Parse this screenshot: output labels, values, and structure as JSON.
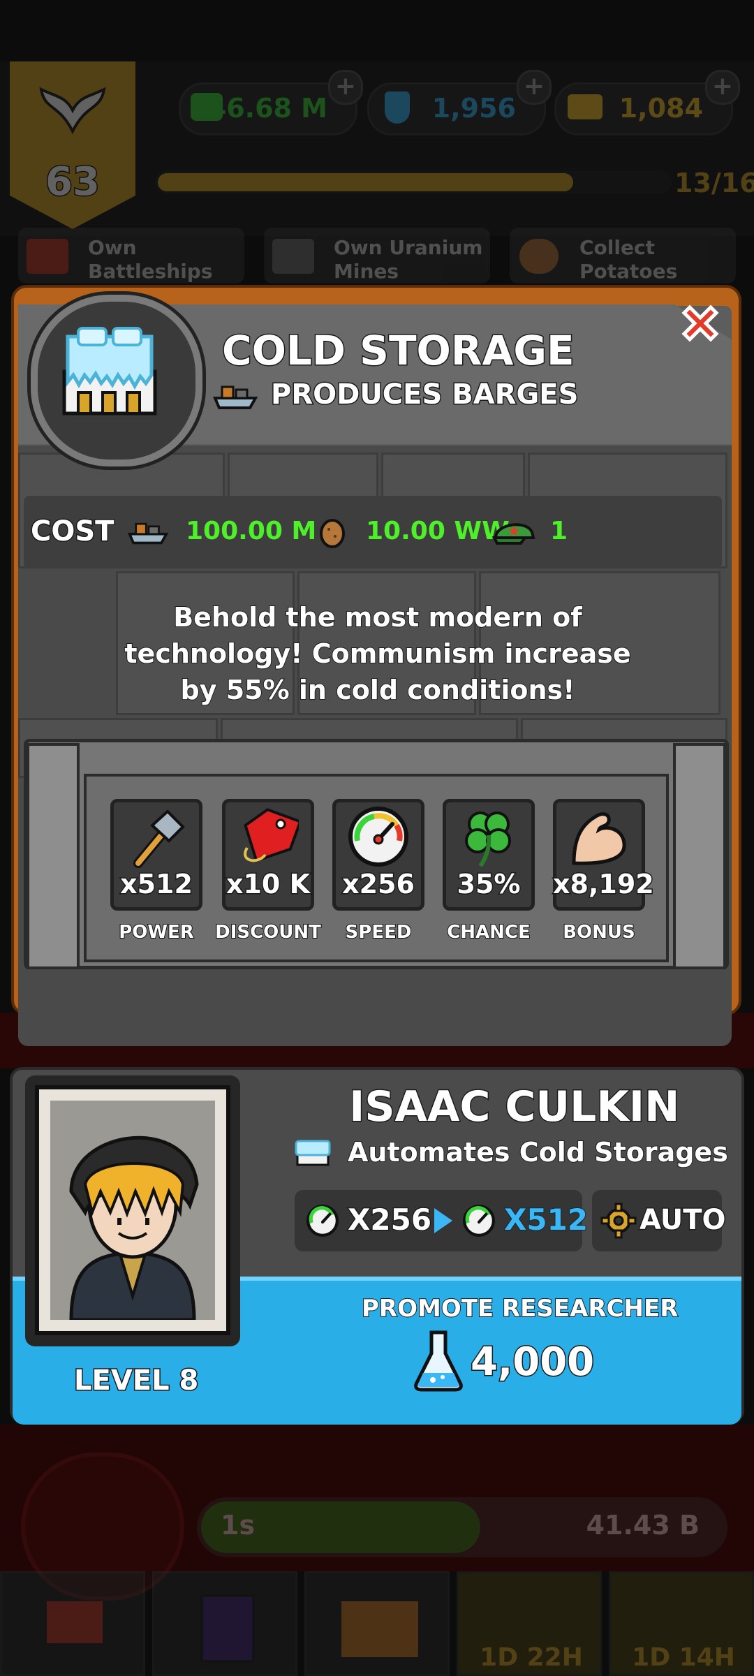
{
  "background": {
    "player_level": "63",
    "currencies": [
      {
        "name": "money",
        "value": "146.68 M",
        "color": "#3bd43b"
      },
      {
        "name": "science",
        "value": "1,956",
        "color": "#3bb7f5"
      },
      {
        "name": "gold",
        "value": "1,084",
        "color": "#f2c12e"
      }
    ],
    "progress": {
      "label": "13/16",
      "fraction": 0.8125
    },
    "missions": [
      {
        "label": "Own Battleships"
      },
      {
        "label": "Own Uranium Mines"
      },
      {
        "label": "Collect Potatoes"
      }
    ],
    "production_time": "1s",
    "production_value": "41.43 B",
    "nav_timers": [
      "1D 22H",
      "1D 14H"
    ]
  },
  "building": {
    "title": "COLD STORAGE",
    "produces": "PRODUCES BARGES",
    "cost_label": "COST",
    "costs": [
      {
        "icon": "barge-icon",
        "value": "100.00 M"
      },
      {
        "icon": "potato-icon",
        "value": "10.00 WW"
      },
      {
        "icon": "army-cap-icon",
        "value": "1"
      }
    ],
    "description": "Behold the most modern of technology! Communism increase by 55% in cold conditions!",
    "stats": [
      {
        "icon": "hammer-icon",
        "value": "x512",
        "label": "POWER"
      },
      {
        "icon": "price-tag-icon",
        "value": "x10 K",
        "label": "DISCOUNT"
      },
      {
        "icon": "speedometer-icon",
        "value": "x256",
        "label": "SPEED"
      },
      {
        "icon": "clover-icon",
        "value": "35%",
        "label": "CHANCE"
      },
      {
        "icon": "bicep-icon",
        "value": "x8,192",
        "label": "BONUS"
      }
    ]
  },
  "researcher": {
    "name": "ISAAC CULKIN",
    "role": "Automates Cold Storages",
    "speed_from": "X256",
    "speed_to": "X512",
    "auto_label": "AUTO",
    "level": "LEVEL 8",
    "promote_label": "PROMOTE RESEARCHER",
    "promote_cost": "4,000"
  },
  "colors": {
    "green_value": "#4ef02a",
    "blue_value": "#3bb7f5",
    "promote_bar": "#2aaee8",
    "wood": "#b8631c"
  }
}
